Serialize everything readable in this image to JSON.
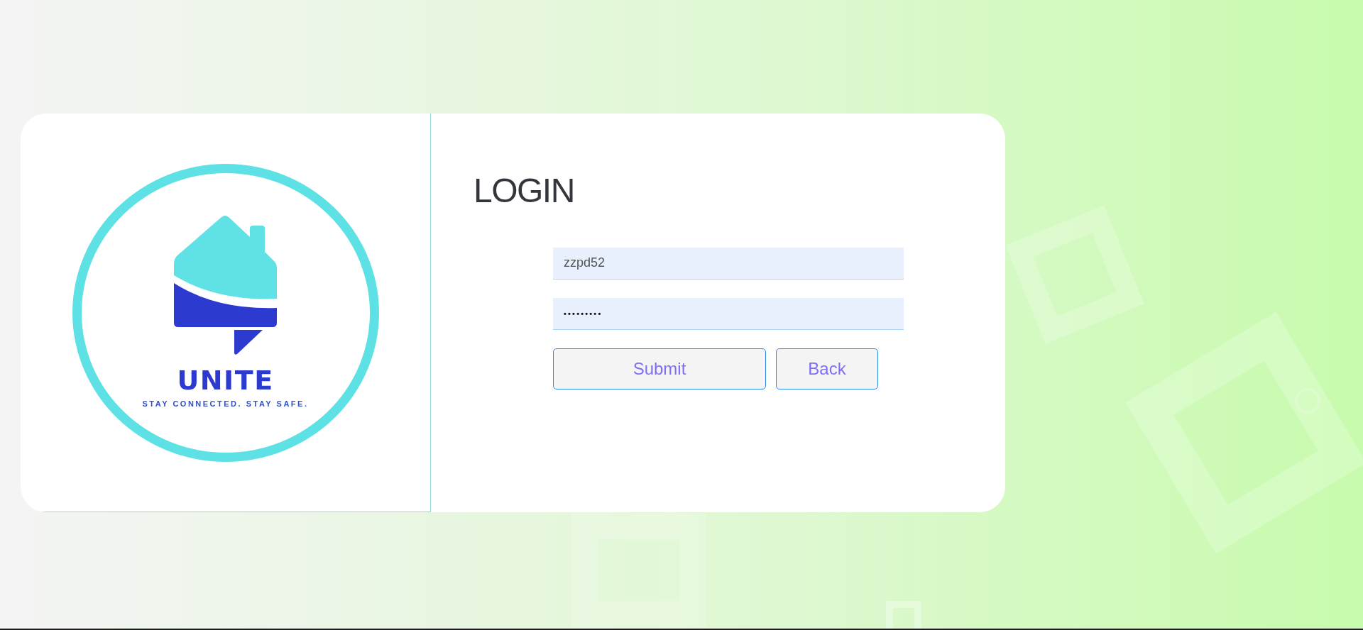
{
  "logo": {
    "name": "UNITE",
    "tagline": "STAY CONNECTED. STAY SAFE."
  },
  "login": {
    "title": "LOGIN",
    "fields": [
      {
        "kind": "text",
        "value": "zzpd52"
      },
      {
        "kind": "password",
        "value": "•••••••••"
      }
    ],
    "buttons": [
      {
        "label": "Submit"
      },
      {
        "label": "Back"
      }
    ]
  }
}
